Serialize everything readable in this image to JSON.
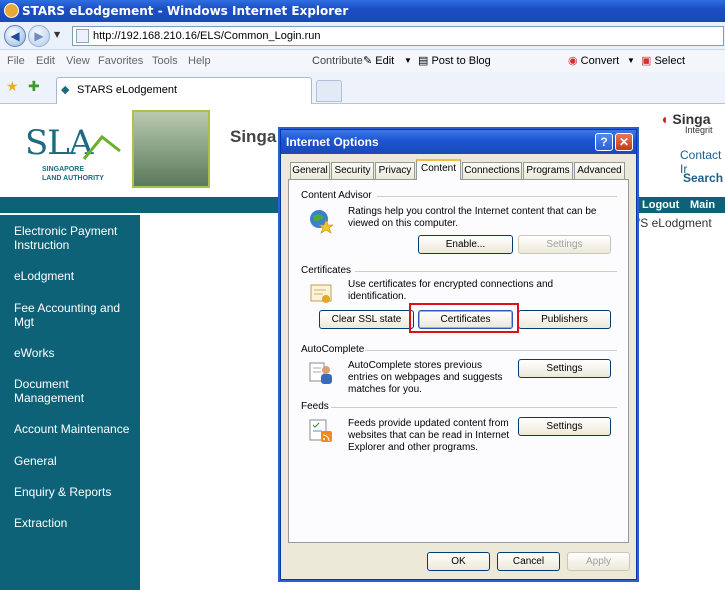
{
  "browser": {
    "title": "STARS eLodgement - Windows Internet Explorer",
    "url": "http://192.168.210.16/ELS/Common_Login.run",
    "menu": [
      "File",
      "Edit",
      "View",
      "Favorites",
      "Tools",
      "Help"
    ],
    "toolbar": {
      "contribute": "Contribute",
      "edit": "Edit",
      "post_to_blog": "Post to Blog",
      "convert": "Convert",
      "select": "Select"
    },
    "tab_title": "STARS eLodgement"
  },
  "page": {
    "logo_text": "SLA",
    "logo_sub_line1": "SINGAPORE",
    "logo_sub_line2": "LAND AUTHORITY",
    "banner_partial": "Singa",
    "right_logo_partial": "Singa",
    "right_logo_sub": "Integrit",
    "contact": "Contact Ir",
    "search": "Search",
    "logout": "Logout",
    "main": "Main",
    "els_partial": "'S eLodgment",
    "sidebar": [
      "Electronic Payment Instruction",
      "eLodgment",
      "Fee Accounting and Mgt",
      "eWorks",
      "Document Management",
      "Account Maintenance",
      "General",
      "Enquiry & Reports",
      "Extraction"
    ]
  },
  "dialog": {
    "title": "Internet Options",
    "tabs": [
      "General",
      "Security",
      "Privacy",
      "Content",
      "Connections",
      "Programs",
      "Advanced"
    ],
    "active_tab": "Content",
    "content_advisor": {
      "heading": "Content Advisor",
      "desc": "Ratings help you control the Internet content that can be viewed on this computer.",
      "enable": "Enable...",
      "settings": "Settings"
    },
    "certificates": {
      "heading": "Certificates",
      "desc": "Use certificates for encrypted connections and identification.",
      "clear_ssl": "Clear SSL state",
      "certificates": "Certificates",
      "publishers": "Publishers"
    },
    "autocomplete": {
      "heading": "AutoComplete",
      "desc": "AutoComplete stores previous entries on webpages and suggests matches for you.",
      "settings": "Settings"
    },
    "feeds": {
      "heading": "Feeds",
      "desc": "Feeds provide updated content from websites that can be read in Internet Explorer and other programs.",
      "settings": "Settings"
    },
    "ok": "OK",
    "cancel": "Cancel",
    "apply": "Apply"
  },
  "colors": {
    "teal": "#0e6278",
    "highlight": "#e0101a"
  }
}
